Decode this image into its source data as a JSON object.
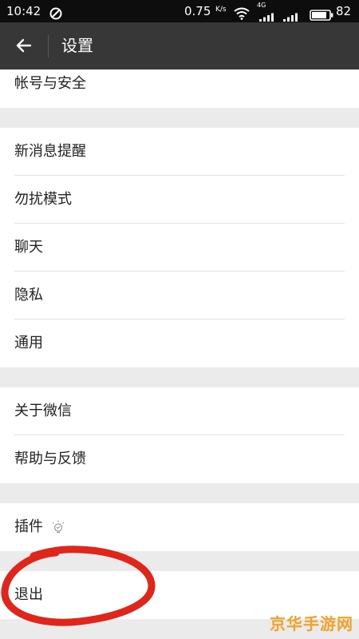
{
  "status_bar": {
    "time": "10:42",
    "speed": "0.75",
    "speed_unit": "K/s",
    "network": "4G",
    "battery": "82"
  },
  "header": {
    "title": "设置"
  },
  "groups": [
    {
      "items": [
        {
          "label": "帐号与安全"
        }
      ]
    },
    {
      "items": [
        {
          "label": "新消息提醒"
        },
        {
          "label": "勿扰模式"
        },
        {
          "label": "聊天"
        },
        {
          "label": "隐私"
        },
        {
          "label": "通用"
        }
      ]
    },
    {
      "items": [
        {
          "label": "关于微信"
        },
        {
          "label": "帮助与反馈"
        }
      ]
    },
    {
      "items": [
        {
          "label": "插件"
        }
      ]
    },
    {
      "items": [
        {
          "label": "退出"
        }
      ]
    }
  ],
  "watermark": "京华手游网",
  "colors": {
    "status_bg": "#0d0d0d",
    "app_bar_bg": "#373737",
    "page_bg": "#ebebeb",
    "annotation": "#e0251b",
    "watermark": "#f2a12b"
  },
  "icons": {
    "back": "arrow-left-icon",
    "plugin": "lightbulb-icon",
    "annotation": "red-circle-annotation"
  }
}
